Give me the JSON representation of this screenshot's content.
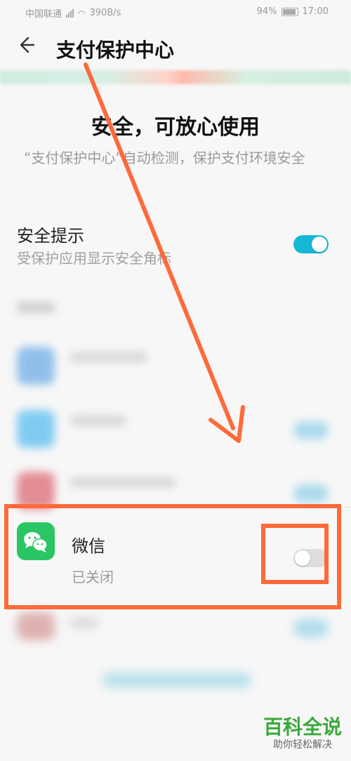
{
  "status_bar": {
    "carrier": "中国联通",
    "speed": "390B/s",
    "battery": "94%",
    "time": "17:00"
  },
  "app_bar": {
    "back_icon": "arrow-left-icon",
    "title": "支付保护中心"
  },
  "summary": {
    "headline": "安全，可放心使用",
    "description": "“支付保护中心”自动检测，保护支付环境安全"
  },
  "security_tip": {
    "title": "安全提示",
    "subtitle": "受保护应用显示安全角标",
    "enabled": true
  },
  "apps": [
    {
      "name": "微信",
      "status": "已关闭",
      "enabled": false,
      "icon": "wechat-icon"
    }
  ],
  "watermark": {
    "brand": "百科全说",
    "tagline": "助你轻松解决"
  },
  "colors": {
    "toggle_on": "#17b7d6",
    "toggle_off": "#dedede",
    "annotation": "#ff6a3a",
    "wechat_green": "#2ac663"
  }
}
